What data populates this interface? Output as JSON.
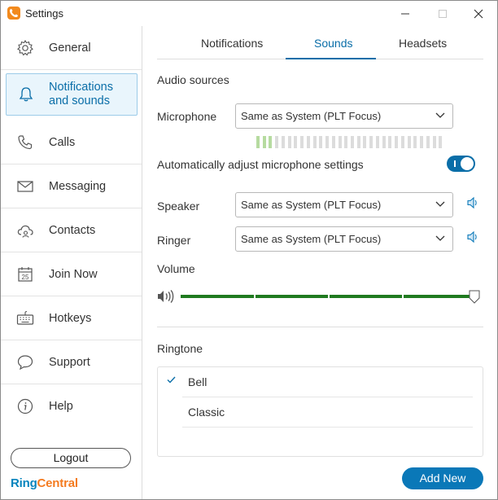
{
  "window": {
    "title": "Settings",
    "app_icon": "phone-icon",
    "controls": [
      "minimize-icon",
      "maximize-icon",
      "close-icon"
    ]
  },
  "sidebar": {
    "items": [
      {
        "label": "General",
        "icon": "gear-icon"
      },
      {
        "label": "Notifications and sounds",
        "icon": "bell-icon",
        "active": true
      },
      {
        "label": "Calls",
        "icon": "phone-icon"
      },
      {
        "label": "Messaging",
        "icon": "envelope-icon"
      },
      {
        "label": "Contacts",
        "icon": "cloud-contacts-icon"
      },
      {
        "label": "Join Now",
        "icon": "calendar-icon"
      },
      {
        "label": "Hotkeys",
        "icon": "keyboard-icon"
      },
      {
        "label": "Support",
        "icon": "speech-bubble-icon"
      },
      {
        "label": "Help",
        "icon": "info-icon"
      }
    ],
    "logout_label": "Logout",
    "brand": {
      "part1": "Ring",
      "part2": "Central"
    }
  },
  "tabs": [
    {
      "label": "Notifications"
    },
    {
      "label": "Sounds",
      "active": true
    },
    {
      "label": "Headsets"
    }
  ],
  "audio": {
    "section_title": "Audio sources",
    "microphone": {
      "label": "Microphone",
      "value": "Same as System (PLT Focus)",
      "level_segments_lit": 3,
      "level_segments_total": 30
    },
    "auto_adjust": {
      "label": "Automatically adjust microphone settings",
      "enabled": true
    },
    "speaker": {
      "label": "Speaker",
      "value": "Same as System (PLT Focus)"
    },
    "ringer": {
      "label": "Ringer",
      "value": "Same as System (PLT Focus)"
    },
    "volume": {
      "label": "Volume",
      "level_percent": 100
    }
  },
  "ringtone": {
    "section_title": "Ringtone",
    "options": [
      {
        "label": "Bell",
        "selected": true
      },
      {
        "label": "Classic",
        "selected": false
      }
    ],
    "add_new_label": "Add New"
  },
  "colors": {
    "accent": "#0a6ea8",
    "volume_bar": "#1f7a1f",
    "brand_orange": "#f47b20",
    "brand_blue": "#0684bd"
  }
}
